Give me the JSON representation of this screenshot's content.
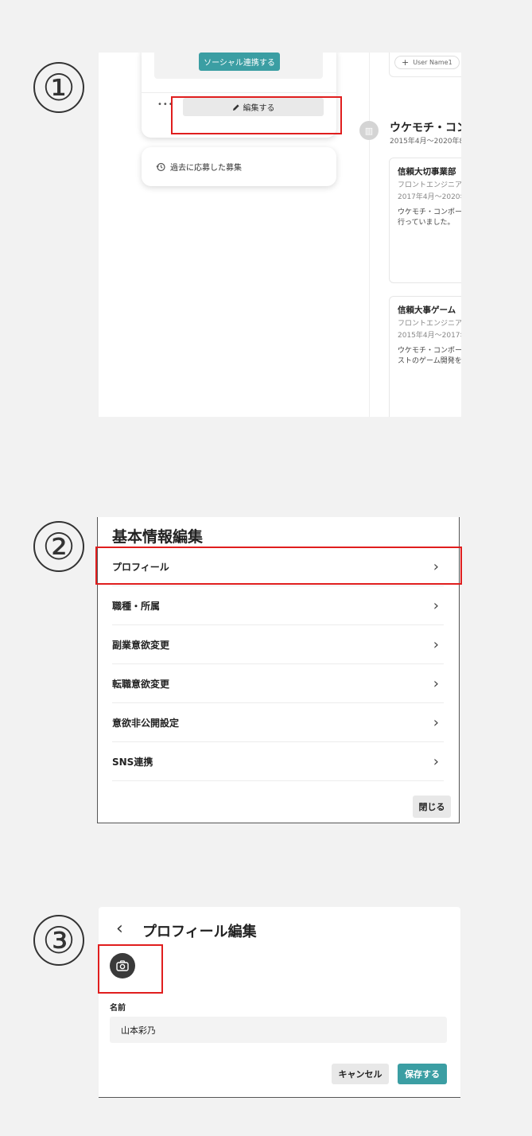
{
  "steps": [
    "①",
    "②",
    "③"
  ],
  "colors": {
    "accent": "#3b9ea3",
    "highlight": "#e01e1e",
    "background": "#f2f2f2"
  },
  "screen1": {
    "social_button": "ソーシャル連携する",
    "more_dots": "•••",
    "edit_button": "編集する",
    "past_applications": "過去に応募した募集",
    "user_chip": "User Name1",
    "company_name": "ウケモチ・コン",
    "company_period": "2015年4月〜2020年8",
    "jobs": [
      {
        "title": "信頼大切事業部",
        "role": "フロントエンジニア",
        "period": "2017年4月〜2020年",
        "desc1": "ウケモチ・コンポー",
        "desc2": "行っていました。"
      },
      {
        "title": "信頼大事ゲーム",
        "role": "フロントエンジニア",
        "period": "2015年4月〜2017年",
        "desc1": "ウケモチ・コンポー",
        "desc2": "ストのゲーム開発を"
      }
    ]
  },
  "screen2": {
    "title": "基本情報編集",
    "menu": [
      {
        "label": "プロフィール"
      },
      {
        "label": "職種・所属"
      },
      {
        "label": "副業意欲変更"
      },
      {
        "label": "転職意欲変更"
      },
      {
        "label": "意欲非公開設定"
      },
      {
        "label": "SNS連携"
      }
    ],
    "close_button": "閉じる"
  },
  "screen3": {
    "title": "プロフィール編集",
    "name_label": "名前",
    "name_value": "山本彩乃",
    "cancel_button": "キャンセル",
    "save_button": "保存する"
  }
}
